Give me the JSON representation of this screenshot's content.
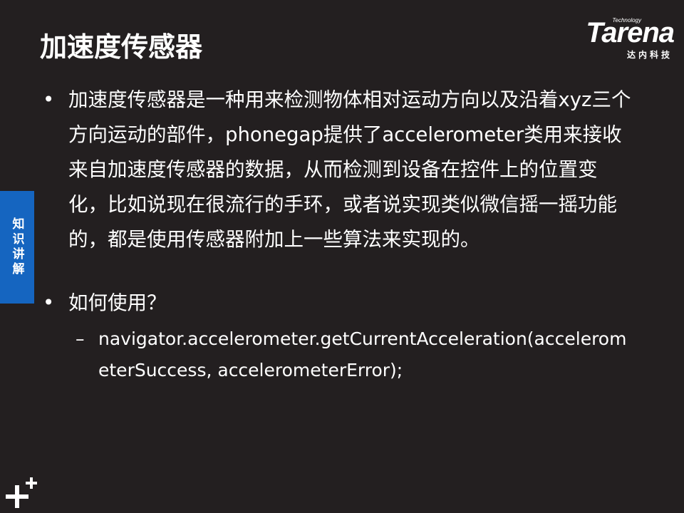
{
  "slide": {
    "title": "加速度传感器",
    "side_tab": "知识讲解"
  },
  "logo": {
    "small_text": "Technology",
    "brand": "Tarena",
    "subtitle": "达内科技"
  },
  "bullets": [
    {
      "marker": "•",
      "text": "加速度传感器是一种用来检测物体相对运动方向以及沿着xyz三个方向运动的部件，phonegap提供了accelerometer类用来接收来自加速度传感器的数据，从而检测到设备在控件上的位置变化，比如说现在很流行的手环，或者说实现类似微信摇一摇功能的，都是使用传感器附加上一些算法来实现的。"
    },
    {
      "marker": "•",
      "text": "如何使用？",
      "sub": {
        "marker": "–",
        "text": "navigator.accelerometer.getCurrentAcceleration(accelerometerSuccess, accelerometerError);"
      }
    }
  ],
  "colors": {
    "background": "#231f20",
    "side_tab": "#1565c0",
    "text": "#ffffff"
  },
  "icons": {
    "corner": "plus-plus-icon"
  }
}
